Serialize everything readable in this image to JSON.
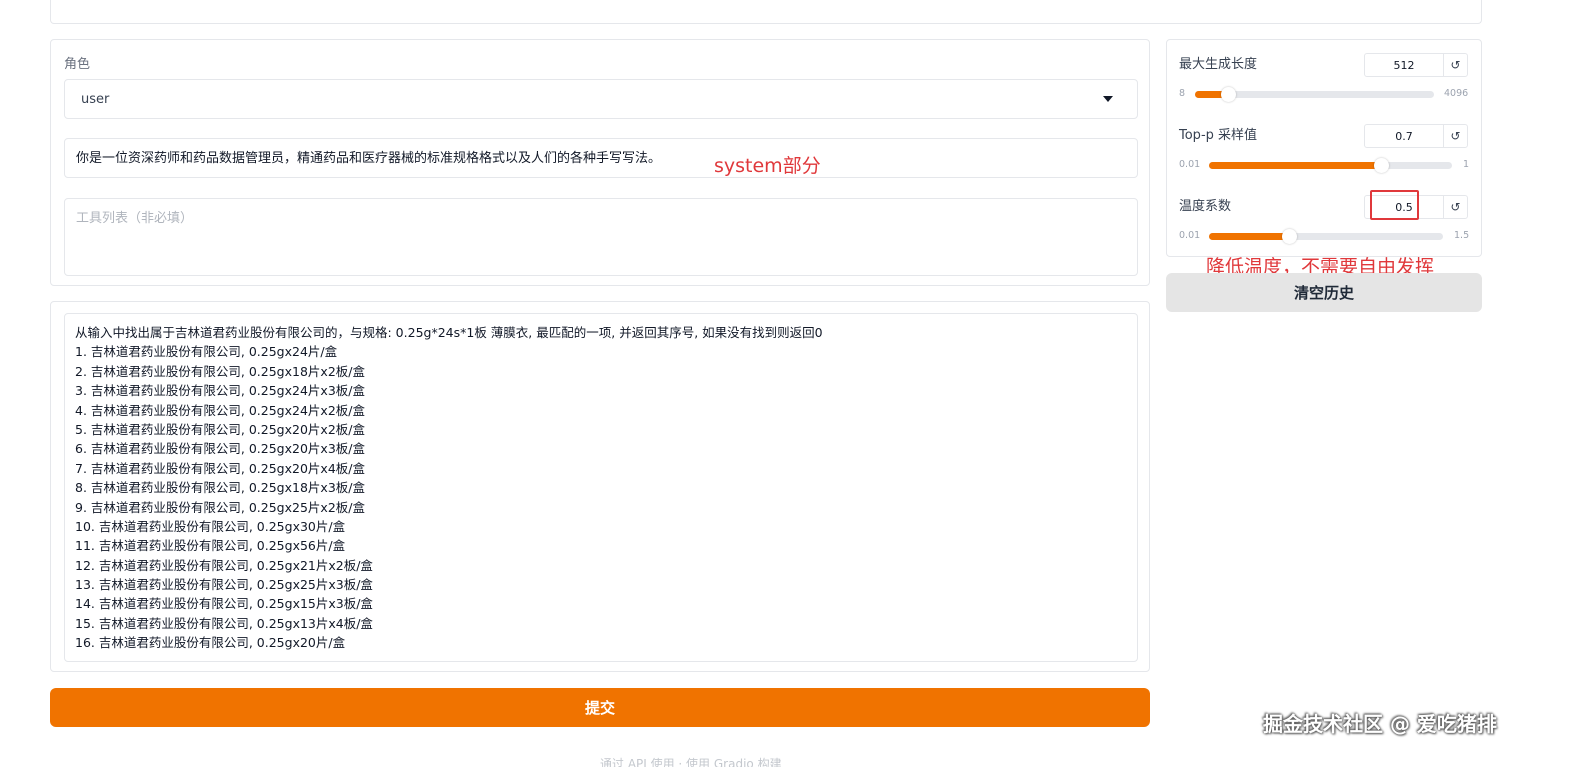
{
  "system": {
    "role_label": "角色",
    "role_value": "user",
    "system_text": "你是一位资深药师和药品数据管理员，精通药品和医疗器械的标准规格格式以及人们的各种手写写法。",
    "tools_placeholder": "工具列表（非必填）"
  },
  "query": {
    "lines": [
      "从输入中找出属于吉林道君药业股份有限公司的，与规格: 0.25g*24s*1板 薄膜衣, 最匹配的一项, 并返回其序号, 如果没有找到则返回0",
      "1. 吉林道君药业股份有限公司, 0.25gx24片/盒",
      "2. 吉林道君药业股份有限公司, 0.25gx18片x2板/盒",
      "3. 吉林道君药业股份有限公司, 0.25gx24片x3板/盒",
      "4. 吉林道君药业股份有限公司, 0.25gx24片x2板/盒",
      "5. 吉林道君药业股份有限公司, 0.25gx20片x2板/盒",
      "6. 吉林道君药业股份有限公司, 0.25gx20片x3板/盒",
      "7. 吉林道君药业股份有限公司, 0.25gx20片x4板/盒",
      "8. 吉林道君药业股份有限公司, 0.25gx18片x3板/盒",
      "9. 吉林道君药业股份有限公司, 0.25gx25片x2板/盒",
      "10. 吉林道君药业股份有限公司, 0.25gx30片/盒",
      "11. 吉林道君药业股份有限公司, 0.25gx56片/盒",
      "12. 吉林道君药业股份有限公司, 0.25gx21片x2板/盒",
      "13. 吉林道君药业股份有限公司, 0.25gx25片x3板/盒",
      "14. 吉林道君药业股份有限公司, 0.25gx15片x3板/盒",
      "15. 吉林道君药业股份有限公司, 0.25gx13片x4板/盒",
      "16. 吉林道君药业股份有限公司, 0.25gx20片/盒"
    ]
  },
  "submit_label": "提交",
  "clear_label": "清空历史",
  "params": {
    "max_length": {
      "label": "最大生成长度",
      "value": "512",
      "min": "8",
      "max": "4096",
      "fraction": 0.124
    },
    "top_p": {
      "label": "Top-p 采样值",
      "value": "0.7",
      "min": "0.01",
      "max": "1",
      "fraction": 0.697
    },
    "temperature": {
      "label": "温度系数",
      "value": "0.5",
      "min": "0.01",
      "max": "1.5",
      "fraction": 0.329
    },
    "reset_glyph": "↺"
  },
  "annotations": {
    "system": "system部分",
    "temperature": "降低温度，不需要自由发挥"
  },
  "watermark": "掘金技术社区 @ 爱吃猪排",
  "footer_faint": "通过 API 使用 · 使用 Gradio 构建",
  "colors": {
    "accent": "#f07300",
    "annotation": "#e0383b"
  }
}
